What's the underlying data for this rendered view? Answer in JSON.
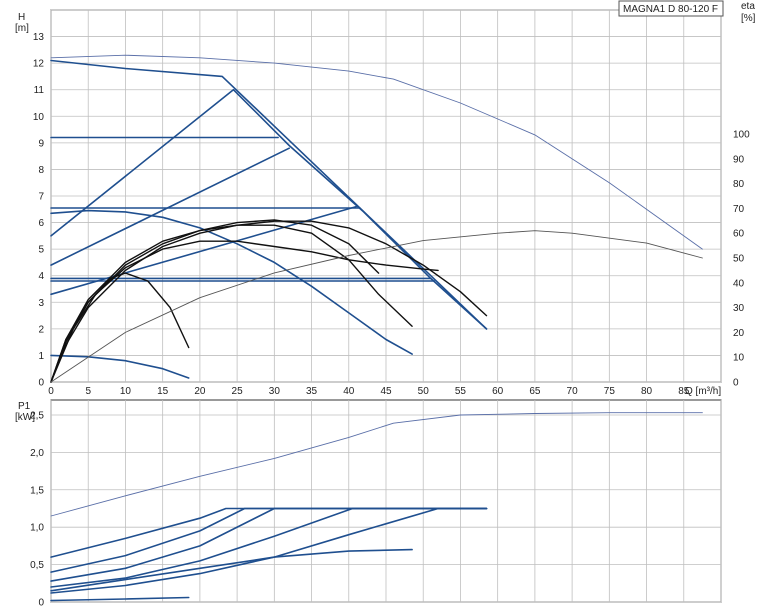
{
  "chart_data": [
    {
      "type": "line",
      "title": "MAGNA1 D 80-120 F",
      "xlabel": "Q [m³/h]",
      "ylabel": "H\n[m]",
      "y2label": "eta\n[%]",
      "xlim": [
        0,
        90
      ],
      "ylim": [
        0,
        14
      ],
      "y2lim": [
        0,
        150
      ],
      "x_ticks": [
        "0",
        "5",
        "10",
        "15",
        "20",
        "25",
        "30",
        "35",
        "40",
        "45",
        "50",
        "55",
        "60",
        "65",
        "70",
        "75",
        "80",
        "85"
      ],
      "y_ticks": [
        "0",
        "1",
        "2",
        "3",
        "4",
        "5",
        "6",
        "7",
        "8",
        "9",
        "10",
        "11",
        "12",
        "13"
      ],
      "y2_ticks": [
        "0",
        "10",
        "20",
        "30",
        "40",
        "50",
        "60",
        "70",
        "80",
        "90",
        "100"
      ],
      "grid": true,
      "colors": {
        "grid": "#bfbfbf",
        "blue": "#1f4f8f",
        "blue_light": "#5a6fa8",
        "black": "#111111",
        "gray": "#555555"
      },
      "series": [
        {
          "style": "blue",
          "x": [
            0,
            10,
            23,
            58.5
          ],
          "y": [
            12.1,
            11.8,
            11.5,
            2.0
          ]
        },
        {
          "style": "blue",
          "x": [
            0,
            24.5,
            27,
            32,
            42,
            51,
            58.5
          ],
          "y": [
            5.5,
            11.0,
            10.3,
            8.9,
            6.4,
            3.9,
            2.0
          ]
        },
        {
          "style": "blue",
          "x": [
            0,
            32
          ],
          "y": [
            4.4,
            8.8
          ]
        },
        {
          "style": "blue",
          "x": [
            0,
            41
          ],
          "y": [
            3.3,
            6.6
          ]
        },
        {
          "style": "blue",
          "x": [
            0,
            30.5
          ],
          "y": [
            9.2,
            9.2
          ]
        },
        {
          "style": "blue",
          "x": [
            0,
            41.5
          ],
          "y": [
            6.55,
            6.55
          ]
        },
        {
          "style": "blue",
          "x": [
            0,
            51
          ],
          "y": [
            3.9,
            3.9
          ]
        },
        {
          "style": "blue",
          "x": [
            0,
            51.5
          ],
          "y": [
            3.8,
            3.8
          ]
        },
        {
          "style": "blue",
          "x": [
            0,
            5,
            10,
            15,
            20,
            25,
            30,
            35,
            40,
            45,
            48.5
          ],
          "y": [
            6.35,
            6.45,
            6.4,
            6.2,
            5.8,
            5.2,
            4.5,
            3.6,
            2.6,
            1.6,
            1.05
          ]
        },
        {
          "style": "blue",
          "x": [
            0,
            5,
            10,
            15,
            18.5
          ],
          "y": [
            1.0,
            0.95,
            0.8,
            0.5,
            0.15
          ]
        },
        {
          "style": "black",
          "x": [
            0,
            2,
            5,
            10,
            15,
            20,
            25,
            30,
            35,
            40,
            45,
            50,
            55,
            58.5
          ],
          "y": [
            0,
            1.4,
            2.8,
            4.2,
            5.1,
            5.6,
            5.9,
            6.05,
            6.05,
            5.8,
            5.2,
            4.4,
            3.4,
            2.5
          ]
        },
        {
          "style": "black",
          "x": [
            0,
            2,
            5,
            10,
            15,
            20,
            25,
            30,
            35,
            40,
            44
          ],
          "y": [
            0,
            1.6,
            3.1,
            4.5,
            5.3,
            5.7,
            6.0,
            6.1,
            5.9,
            5.2,
            4.1
          ]
        },
        {
          "style": "black",
          "x": [
            0,
            2,
            5,
            10,
            15,
            20,
            25,
            30,
            35,
            40,
            44,
            48.5
          ],
          "y": [
            0,
            1.5,
            3.0,
            4.4,
            5.2,
            5.7,
            5.9,
            5.9,
            5.6,
            4.6,
            3.3,
            2.1
          ]
        },
        {
          "style": "black",
          "x": [
            0,
            2,
            5,
            8,
            10,
            13,
            16,
            18.5
          ],
          "y": [
            0,
            1.6,
            3.0,
            3.9,
            4.1,
            3.8,
            2.8,
            1.3
          ]
        },
        {
          "style": "black",
          "x": [
            0,
            3,
            6,
            10,
            15,
            20,
            25,
            30,
            35,
            40,
            45,
            50,
            52
          ],
          "y": [
            0,
            2.0,
            3.3,
            4.3,
            5.0,
            5.3,
            5.3,
            5.1,
            4.9,
            4.6,
            4.4,
            4.25,
            4.2
          ]
        },
        {
          "style": "gray",
          "y_axis": "right",
          "x": [
            0,
            10,
            20,
            30,
            40,
            50,
            60,
            65,
            70,
            80,
            87.5
          ],
          "y": [
            0,
            20,
            34,
            44,
            51,
            57,
            60,
            61,
            60,
            56,
            50
          ]
        },
        {
          "style": "blue_light",
          "y_axis": "right",
          "x": [
            0,
            10,
            20,
            30,
            40,
            46,
            55,
            65,
            75,
            87.5
          ],
          "y": [
            0,
            0,
            0,
            0,
            0,
            0,
            0,
            0,
            0,
            0
          ]
        }
      ],
      "extra_curves": [
        {
          "style": "blue_light",
          "x": [
            0,
            10,
            20,
            30,
            40,
            46,
            55,
            65,
            75,
            87.5
          ],
          "y": [
            12.2,
            12.3,
            12.2,
            12.0,
            11.7,
            11.4,
            10.5,
            9.3,
            7.5,
            5.0
          ]
        }
      ]
    },
    {
      "type": "line",
      "ylabel": "P1\n[kW]",
      "xlim": [
        0,
        90
      ],
      "ylim": [
        0,
        2.7
      ],
      "x_ticks": [
        "0",
        "5",
        "10",
        "15",
        "20",
        "25",
        "30",
        "35",
        "40",
        "45",
        "50",
        "55",
        "60",
        "65",
        "70",
        "75",
        "80",
        "85"
      ],
      "y_ticks": [
        "0",
        "0,5",
        "1,0",
        "1,5",
        "2,0",
        "2,5"
      ],
      "grid": true,
      "series": [
        {
          "style": "blue_light",
          "x": [
            0,
            10,
            20,
            30,
            40,
            46,
            55,
            65,
            75,
            87.5
          ],
          "y": [
            1.15,
            1.42,
            1.68,
            1.92,
            2.2,
            2.39,
            2.5,
            2.52,
            2.53,
            2.53
          ]
        },
        {
          "style": "blue",
          "x": [
            0,
            10,
            20,
            23.5,
            58.5
          ],
          "y": [
            0.6,
            0.85,
            1.12,
            1.25,
            1.25
          ]
        },
        {
          "style": "blue",
          "x": [
            0,
            10,
            20,
            26,
            58.5
          ],
          "y": [
            0.4,
            0.62,
            0.95,
            1.25,
            1.25
          ]
        },
        {
          "style": "blue",
          "x": [
            0,
            10,
            20,
            30,
            58.5
          ],
          "y": [
            0.28,
            0.45,
            0.75,
            1.25,
            1.25
          ]
        },
        {
          "style": "blue",
          "x": [
            0,
            10,
            20,
            30,
            40.5,
            58.5
          ],
          "y": [
            0.2,
            0.32,
            0.55,
            0.88,
            1.25,
            1.25
          ]
        },
        {
          "style": "blue",
          "x": [
            0,
            10,
            20,
            30,
            40,
            52,
            58.5
          ],
          "y": [
            0.12,
            0.22,
            0.38,
            0.6,
            0.9,
            1.25,
            1.25
          ]
        },
        {
          "style": "blue",
          "x": [
            0,
            10,
            20,
            30,
            40,
            48.5
          ],
          "y": [
            0.15,
            0.3,
            0.45,
            0.6,
            0.68,
            0.7
          ]
        },
        {
          "style": "blue",
          "x": [
            0,
            10,
            18.5
          ],
          "y": [
            0.02,
            0.04,
            0.06
          ]
        }
      ]
    }
  ]
}
